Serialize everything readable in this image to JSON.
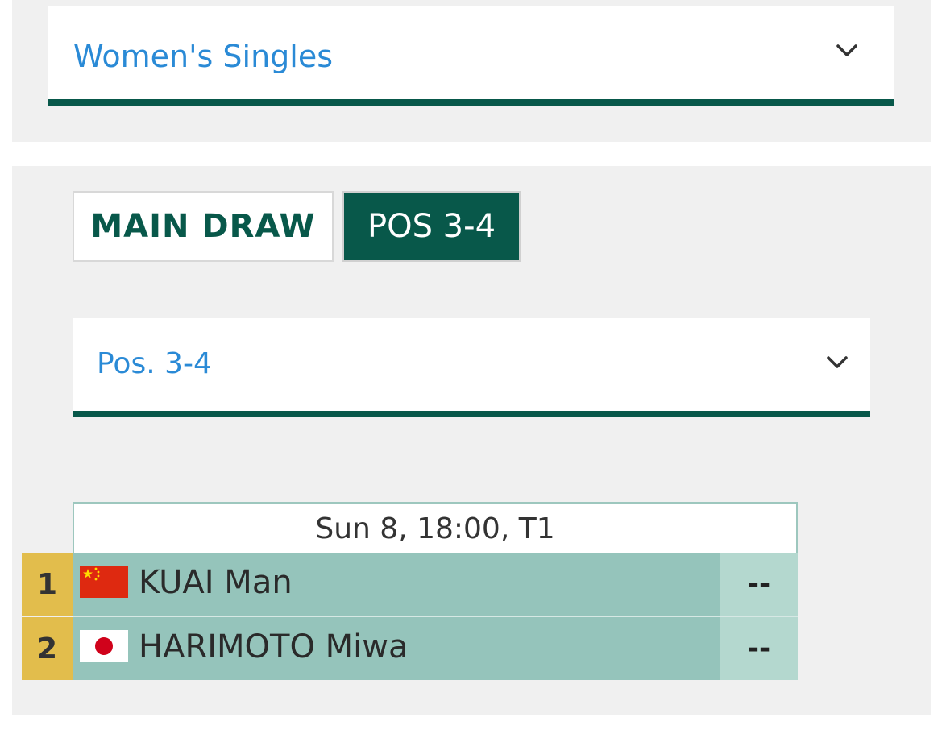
{
  "event_select": {
    "label": "Women's Singles",
    "icon": "chevron-down-icon"
  },
  "tabs": [
    {
      "label": "MAIN DRAW",
      "active": false
    },
    {
      "label": "POS 3-4",
      "active": true
    }
  ],
  "round_select": {
    "label": "Pos. 3-4",
    "icon": "chevron-down-icon"
  },
  "match": {
    "schedule": "Sun 8, 18:00, T1",
    "players": [
      {
        "seed": "1",
        "name": "KUAI Man",
        "country": "CHN",
        "flag_icon": "china-flag-icon",
        "score": "--"
      },
      {
        "seed": "2",
        "name": "HARIMOTO Miwa",
        "country": "JPN",
        "flag_icon": "japan-flag-icon",
        "score": "--"
      }
    ]
  },
  "colors": {
    "accent": "#08584a",
    "link_blue": "#2a8ad6",
    "seed_gold": "#e2bd4c",
    "player_row": "#95c4bb",
    "score_cell": "#b4d8cf",
    "panel_bg": "#f0f0f0"
  }
}
